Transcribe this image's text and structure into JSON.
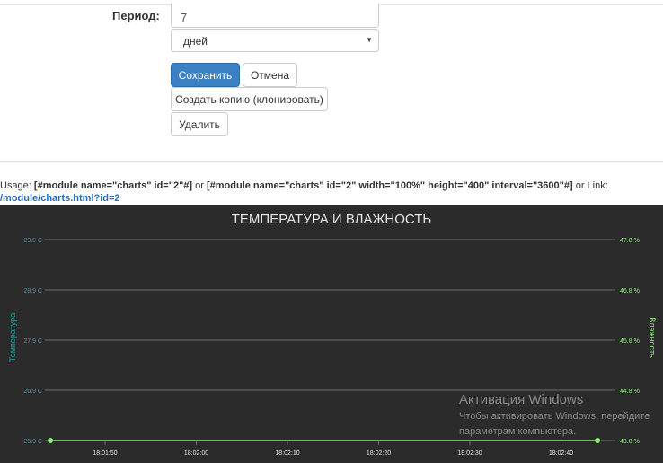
{
  "form": {
    "period_label": "Период:",
    "period_value": "7",
    "unit_value": "дней"
  },
  "buttons": {
    "save": "Сохранить",
    "cancel": "Отмена",
    "clone": "Создать копию (клонировать)",
    "delete": "Удалить"
  },
  "usage": {
    "prefix": "Usage: ",
    "code1": "[#module name=\"charts\" id=\"2\"#]",
    "or1": " or ",
    "code2": "[#module name=\"charts\" id=\"2\" width=\"100%\" height=\"400\" interval=\"3600\"#]",
    "or2": " or Link:",
    "link": "/module/charts.html?id=2"
  },
  "chart_data": {
    "type": "line",
    "title": "ТЕМПЕРАТУРА И ВЛАЖНОСТЬ",
    "ylabel": "Температура",
    "ylabel_right": "Влажность",
    "x_ticks": [
      "18:01:50",
      "18:02:00",
      "18:02:10",
      "18:02:20",
      "18:02:30",
      "18:02:40"
    ],
    "y_ticks": [
      "25.9 C",
      "26.9 C",
      "27.9 C",
      "28.9 C",
      "29.9 C"
    ],
    "y2_ticks": [
      "43.8 %",
      "44.8 %",
      "45.8 %",
      "46.8 %",
      "47.8 %"
    ],
    "ylim": [
      25.9,
      29.9
    ],
    "y2lim": [
      43.8,
      47.8
    ],
    "series": [
      {
        "x": [
          "18:01:44",
          "18:02:44"
        ],
        "values": [
          25.9,
          25.9
        ],
        "color": "#90ee7e"
      }
    ],
    "colors": {
      "background": "#2b2b2c",
      "grid": "#6e6e70",
      "left_axis": "#2aa3a3",
      "right_axis": "#90ee7e",
      "title": "#e6e6e6"
    }
  },
  "watermark": {
    "title": "Активация Windows",
    "line1": "Чтобы активировать Windows, перейдите",
    "line2": "параметрам компьютера."
  }
}
